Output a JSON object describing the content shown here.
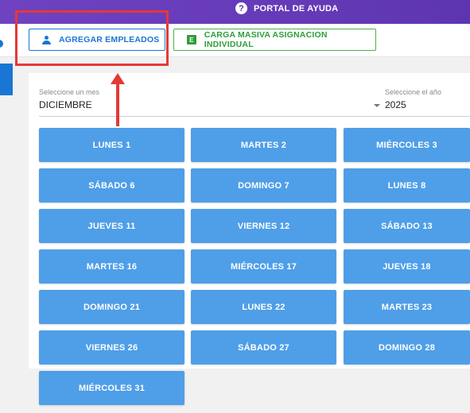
{
  "header": {
    "help_label": "PORTAL DE AYUDA"
  },
  "actions": {
    "add_employees_label": "AGREGAR EMPLEADOS",
    "bulk_upload_label": "CARGA MASIVA ASIGNACION INDIVIDUAL",
    "excel_glyph": "E"
  },
  "filters": {
    "month_label": "Seleccione un mes",
    "month_value": "DICIEMBRE",
    "year_label": "Seleccione el año",
    "year_value": "2025"
  },
  "days": [
    "LUNES 1",
    "MARTES 2",
    "MIÉRCOLES 3",
    "SÁBADO 6",
    "DOMINGO 7",
    "LUNES 8",
    "JUEVES 11",
    "VIERNES 12",
    "SÁBADO 13",
    "MARTES 16",
    "MIÉRCOLES 17",
    "JUEVES 18",
    "DOMINGO 21",
    "LUNES 22",
    "MARTES 23",
    "VIERNES 26",
    "SÁBADO 27",
    "DOMINGO 28",
    "MIÉRCOLES 31"
  ],
  "colors": {
    "header": "#5e35b1",
    "primary": "#1976d2",
    "success": "#2e9e3b",
    "day_button": "#4f9ee8",
    "annotation": "#e53935"
  }
}
